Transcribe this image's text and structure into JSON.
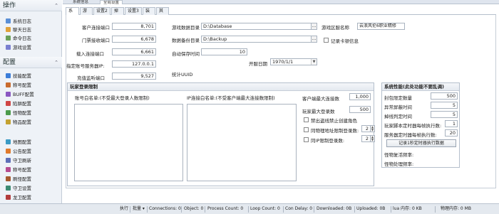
{
  "sidebar": {
    "section_ops": "操作",
    "ops_items": [
      {
        "label": "系统日志",
        "icon": "log-icon",
        "color": "#5a8fd6"
      },
      {
        "label": "聊天日志",
        "icon": "chat-icon",
        "color": "#e0a23a"
      },
      {
        "label": "命令日志",
        "icon": "command-icon",
        "color": "#6ba05a"
      },
      {
        "label": "游戏设置",
        "icon": "settings-icon",
        "color": "#7a7fd0"
      }
    ],
    "section_cfg": "配置",
    "cfg_items": [
      {
        "label": "技能配置",
        "icon": "skill-icon",
        "color": "#3b7dd8"
      },
      {
        "label": "称号配置",
        "icon": "title-icon",
        "color": "#c96b2e"
      },
      {
        "label": "BUFF配置",
        "icon": "buff-icon",
        "color": "#8a57c2"
      },
      {
        "label": "陷阱配置",
        "icon": "trap-icon",
        "color": "#d04545"
      },
      {
        "label": "怪物配置",
        "icon": "monster-icon",
        "color": "#4c9b4c"
      },
      {
        "label": "物品配置",
        "icon": "item-icon",
        "color": "#c4a231"
      },
      {
        "label": "地图配置",
        "icon": "map-icon",
        "color": "#3a9ac4"
      },
      {
        "label": "公告配置",
        "icon": "notice-icon",
        "color": "#e07a2c"
      },
      {
        "label": "守卫刷新",
        "icon": "guard-icon",
        "color": "#5d6fb8"
      },
      {
        "label": "称号配置",
        "icon": "badge-icon",
        "color": "#b64b8f"
      },
      {
        "label": "刷怪配置",
        "icon": "spawn-icon",
        "color": "#a65a2e"
      },
      {
        "label": "守卫设置",
        "icon": "shield-icon",
        "color": "#3c8a72"
      },
      {
        "label": "龙卫配置",
        "icon": "dragon-icon",
        "color": "#b33c3c"
      }
    ]
  },
  "top_tabs": [
    "系统信息",
    "全局设置"
  ],
  "sub_tabs": [
    "系统",
    "游戏",
    "设置2",
    "掉落",
    "设置3",
    "装备",
    "其他"
  ],
  "server": {
    "client_port_label": "客户连接端口",
    "client_port": "8,701",
    "gate_port_label": "门票接收端口",
    "gate_port": "6,678",
    "login_port_label": "载入连接端口",
    "login_port": "6,661",
    "login_ip_label": "指定账号服务器IP:",
    "login_ip": "127.0.0.1",
    "recharge_port_label": "充值监听端口",
    "recharge_port": "9,527",
    "db_dir_label": "游戏数据目录",
    "db_dir": "D:\\Database",
    "backup_dir_label": "数据备份目录",
    "backup_dir": "D:\\Backup",
    "autosave_label": "自动保存时间",
    "autosave": "10",
    "open_date_label": "开服日期",
    "open_date": "1970/1/1",
    "uuid_label": "统计UUID",
    "region_label": "游戏区服名称",
    "region": "云浪风伦6职业精修",
    "log_card_label": "记录卡顿信息"
  },
  "limits": {
    "title": "玩家登录限制",
    "account_whitelist": "账号白名单:(不受最大登录人数限制)",
    "ip_whitelist": "IP连接白名单:(不受客户端最大连接数限制)",
    "max_conn_label": "客户端最大连接数",
    "max_conn": "1,000",
    "max_players_label": "玩家最大登录数",
    "max_players": "500",
    "no_new_chars_label": "禁出盗线禁止创建角色",
    "same_ip_label": "同物理地址限制登录数:",
    "same_ip": "2",
    "same_pc_label": "同IP限制登录数:",
    "same_pc": "2"
  },
  "perf": {
    "title": "系统性能(此处功能不要乱调)",
    "rows": [
      {
        "label": "封包限定数量",
        "value": "500"
      },
      {
        "label": "异常屏蔽时间",
        "value": "5"
      },
      {
        "label": "掉线判定时间",
        "value": "5"
      },
      {
        "label": "玩家脚本定时器每帧执行数:",
        "value": "1"
      },
      {
        "label": "服务器定时器每帧执行数:",
        "value": "20"
      }
    ],
    "record_button": "记录1秒定时器执行数据",
    "monster_hp_label": "怪物复活频率:",
    "monster_ai_label": "怪物处理频率:"
  },
  "status_bar": {
    "run": "执行",
    "batch": "批量",
    "items": [
      "Connections: 0",
      "Object: 0",
      "Process Count: 0",
      "Loop Count: 0",
      "Con Delay: 0",
      "Downloaded: 0B",
      "Uploaded: 0B",
      "lua 内存: 0 KB",
      "物理内存: 0 MB"
    ]
  }
}
